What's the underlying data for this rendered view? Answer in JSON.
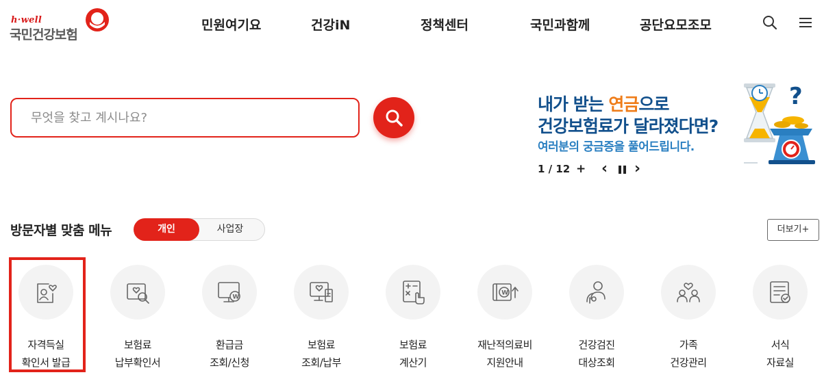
{
  "header": {
    "logo_sub": "h·well",
    "logo_main": "국민건강보험",
    "nav": [
      "민원여기요",
      "건강iN",
      "정책센터",
      "국민과함께",
      "공단요모조모"
    ],
    "icons": [
      "search-icon",
      "menu-icon"
    ]
  },
  "search": {
    "placeholder": "무엇을 찾고 계시나요?",
    "button_icon": "search-icon"
  },
  "banner": {
    "line1_a": "내가 받는 ",
    "line1_highlight": "연금",
    "line1_b": "으로",
    "line2": "건강보험료가 달라졌다면?",
    "line3": "여러분의 궁금증을 풀어드립니다.",
    "page_current": "1",
    "page_sep": " / ",
    "page_total": "12",
    "controls": {
      "add": "+",
      "prev": "‹",
      "pause": "❚❚",
      "next": "›"
    }
  },
  "visitor_menu": {
    "title": "방문자별 맞춤 메뉴",
    "tabs": [
      {
        "label": "개인",
        "active": true
      },
      {
        "label": "사업장",
        "active": false
      }
    ],
    "more_label": "더보기+",
    "items": [
      {
        "line1": "자격득실",
        "line2": "확인서 발급",
        "icon": "qualification-certificate-icon",
        "selected": true
      },
      {
        "line1": "보험료",
        "line2": "납부확인서",
        "icon": "payment-confirmation-icon"
      },
      {
        "line1": "환급금",
        "line2": "조회/신청",
        "icon": "refund-monitor-icon"
      },
      {
        "line1": "보험료",
        "line2": "조회/납부",
        "icon": "premium-inquiry-icon"
      },
      {
        "line1": "보험료",
        "line2": "계산기",
        "icon": "calculator-icon"
      },
      {
        "line1": "재난적의료비",
        "line2": "지원안내",
        "icon": "medical-support-icon"
      },
      {
        "line1": "건강검진",
        "line2": "대상조회",
        "icon": "health-checkup-icon"
      },
      {
        "line1": "가족",
        "line2": "건강관리",
        "icon": "family-health-icon"
      },
      {
        "line1": "서식",
        "line2": "자료실",
        "icon": "form-archive-icon"
      }
    ]
  },
  "colors": {
    "accent": "#e2231a",
    "banner_blue": "#12508c",
    "banner_orange": "#ef7d1a",
    "banner_sub": "#2a7fc1"
  }
}
